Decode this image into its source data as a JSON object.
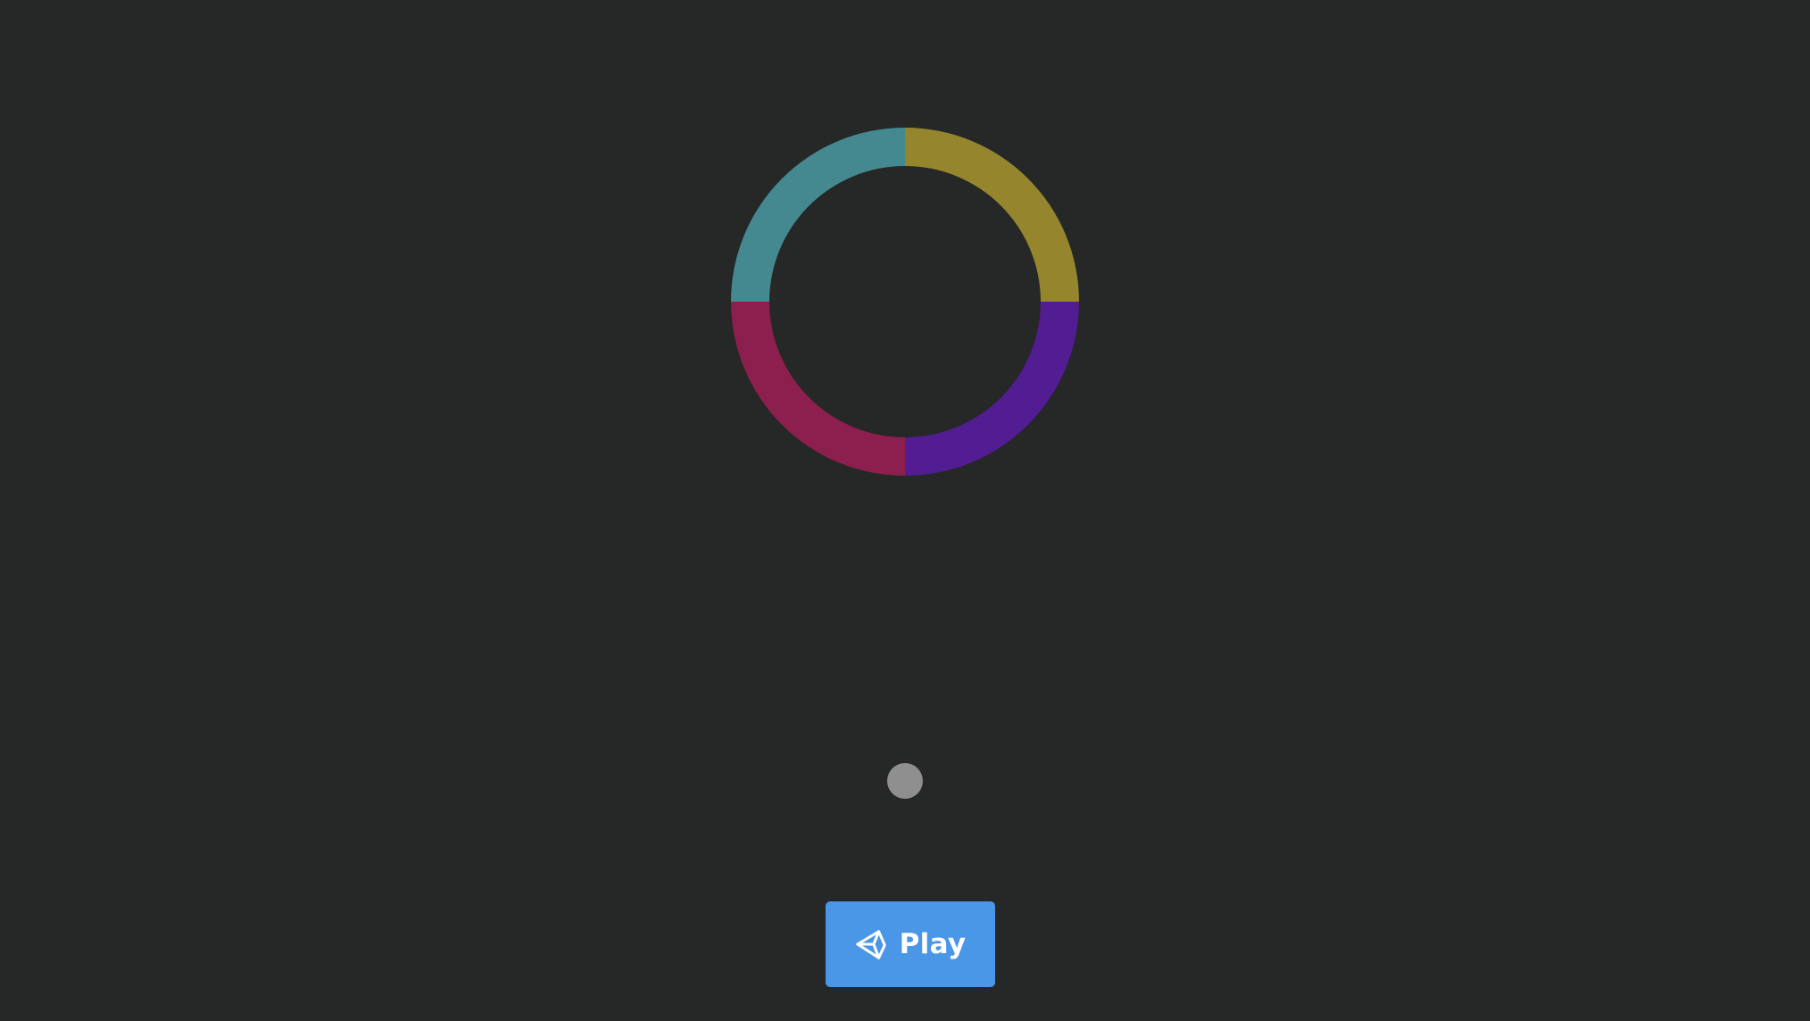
{
  "game": {
    "background_color": "#262727",
    "ring": {
      "segments": [
        {
          "name": "top-right",
          "color": "#95862d"
        },
        {
          "name": "bottom-right",
          "color": "#521c93"
        },
        {
          "name": "bottom-left",
          "color": "#8d1f4e"
        },
        {
          "name": "top-left",
          "color": "#458990"
        }
      ]
    },
    "ball": {
      "color": "#8f8f8f"
    }
  },
  "controls": {
    "play_button": {
      "label": "Play",
      "icon": "unity-logo-icon",
      "color": "#4a97e8"
    }
  }
}
